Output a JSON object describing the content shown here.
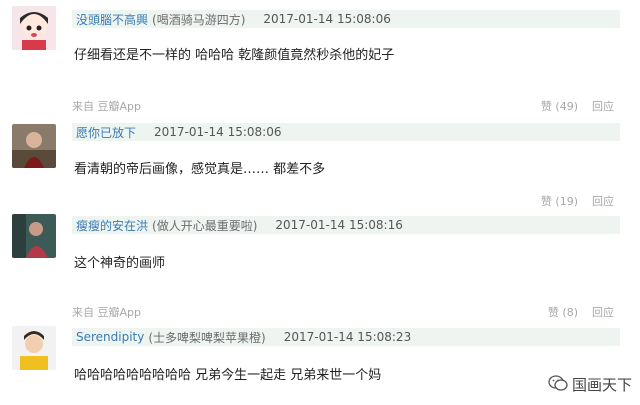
{
  "comments": [
    {
      "username": "没頭腦不高興",
      "signature": "(喝酒骑马游四方)",
      "timestamp": "2017-01-14 15:08:06",
      "text": "仔细看还是不一样的 哈哈哈 乾隆颜值竟然秒杀他的妃子",
      "source": "来自 豆瓣App",
      "like_label": "赞 (49)",
      "reply_label": "回应"
    },
    {
      "username": "愿你已放下",
      "signature": "",
      "timestamp": "2017-01-14 15:08:06",
      "text": "看清朝的帝后画像，感觉真是…… 都差不多",
      "source": "",
      "like_label": "赞 (19)",
      "reply_label": "回应"
    },
    {
      "username": "瘦瘦的安在洪",
      "signature": "(做人开心最重要啦)",
      "timestamp": "2017-01-14 15:08:16",
      "text": "这个神奇的画师",
      "source": "来自 豆瓣App",
      "like_label": "赞 (8)",
      "reply_label": "回应"
    },
    {
      "username": "Serendipity",
      "signature": "(士多啤梨啤梨苹果橙)",
      "timestamp": "2017-01-14 15:08:23",
      "text": "哈哈哈哈哈哈哈哈哈 兄弟今生一起走 兄弟来世一个妈",
      "source": "",
      "like_label": "",
      "reply_label": ""
    }
  ],
  "watermark": {
    "text": "国画天下",
    "icon": "wechat-icon"
  }
}
